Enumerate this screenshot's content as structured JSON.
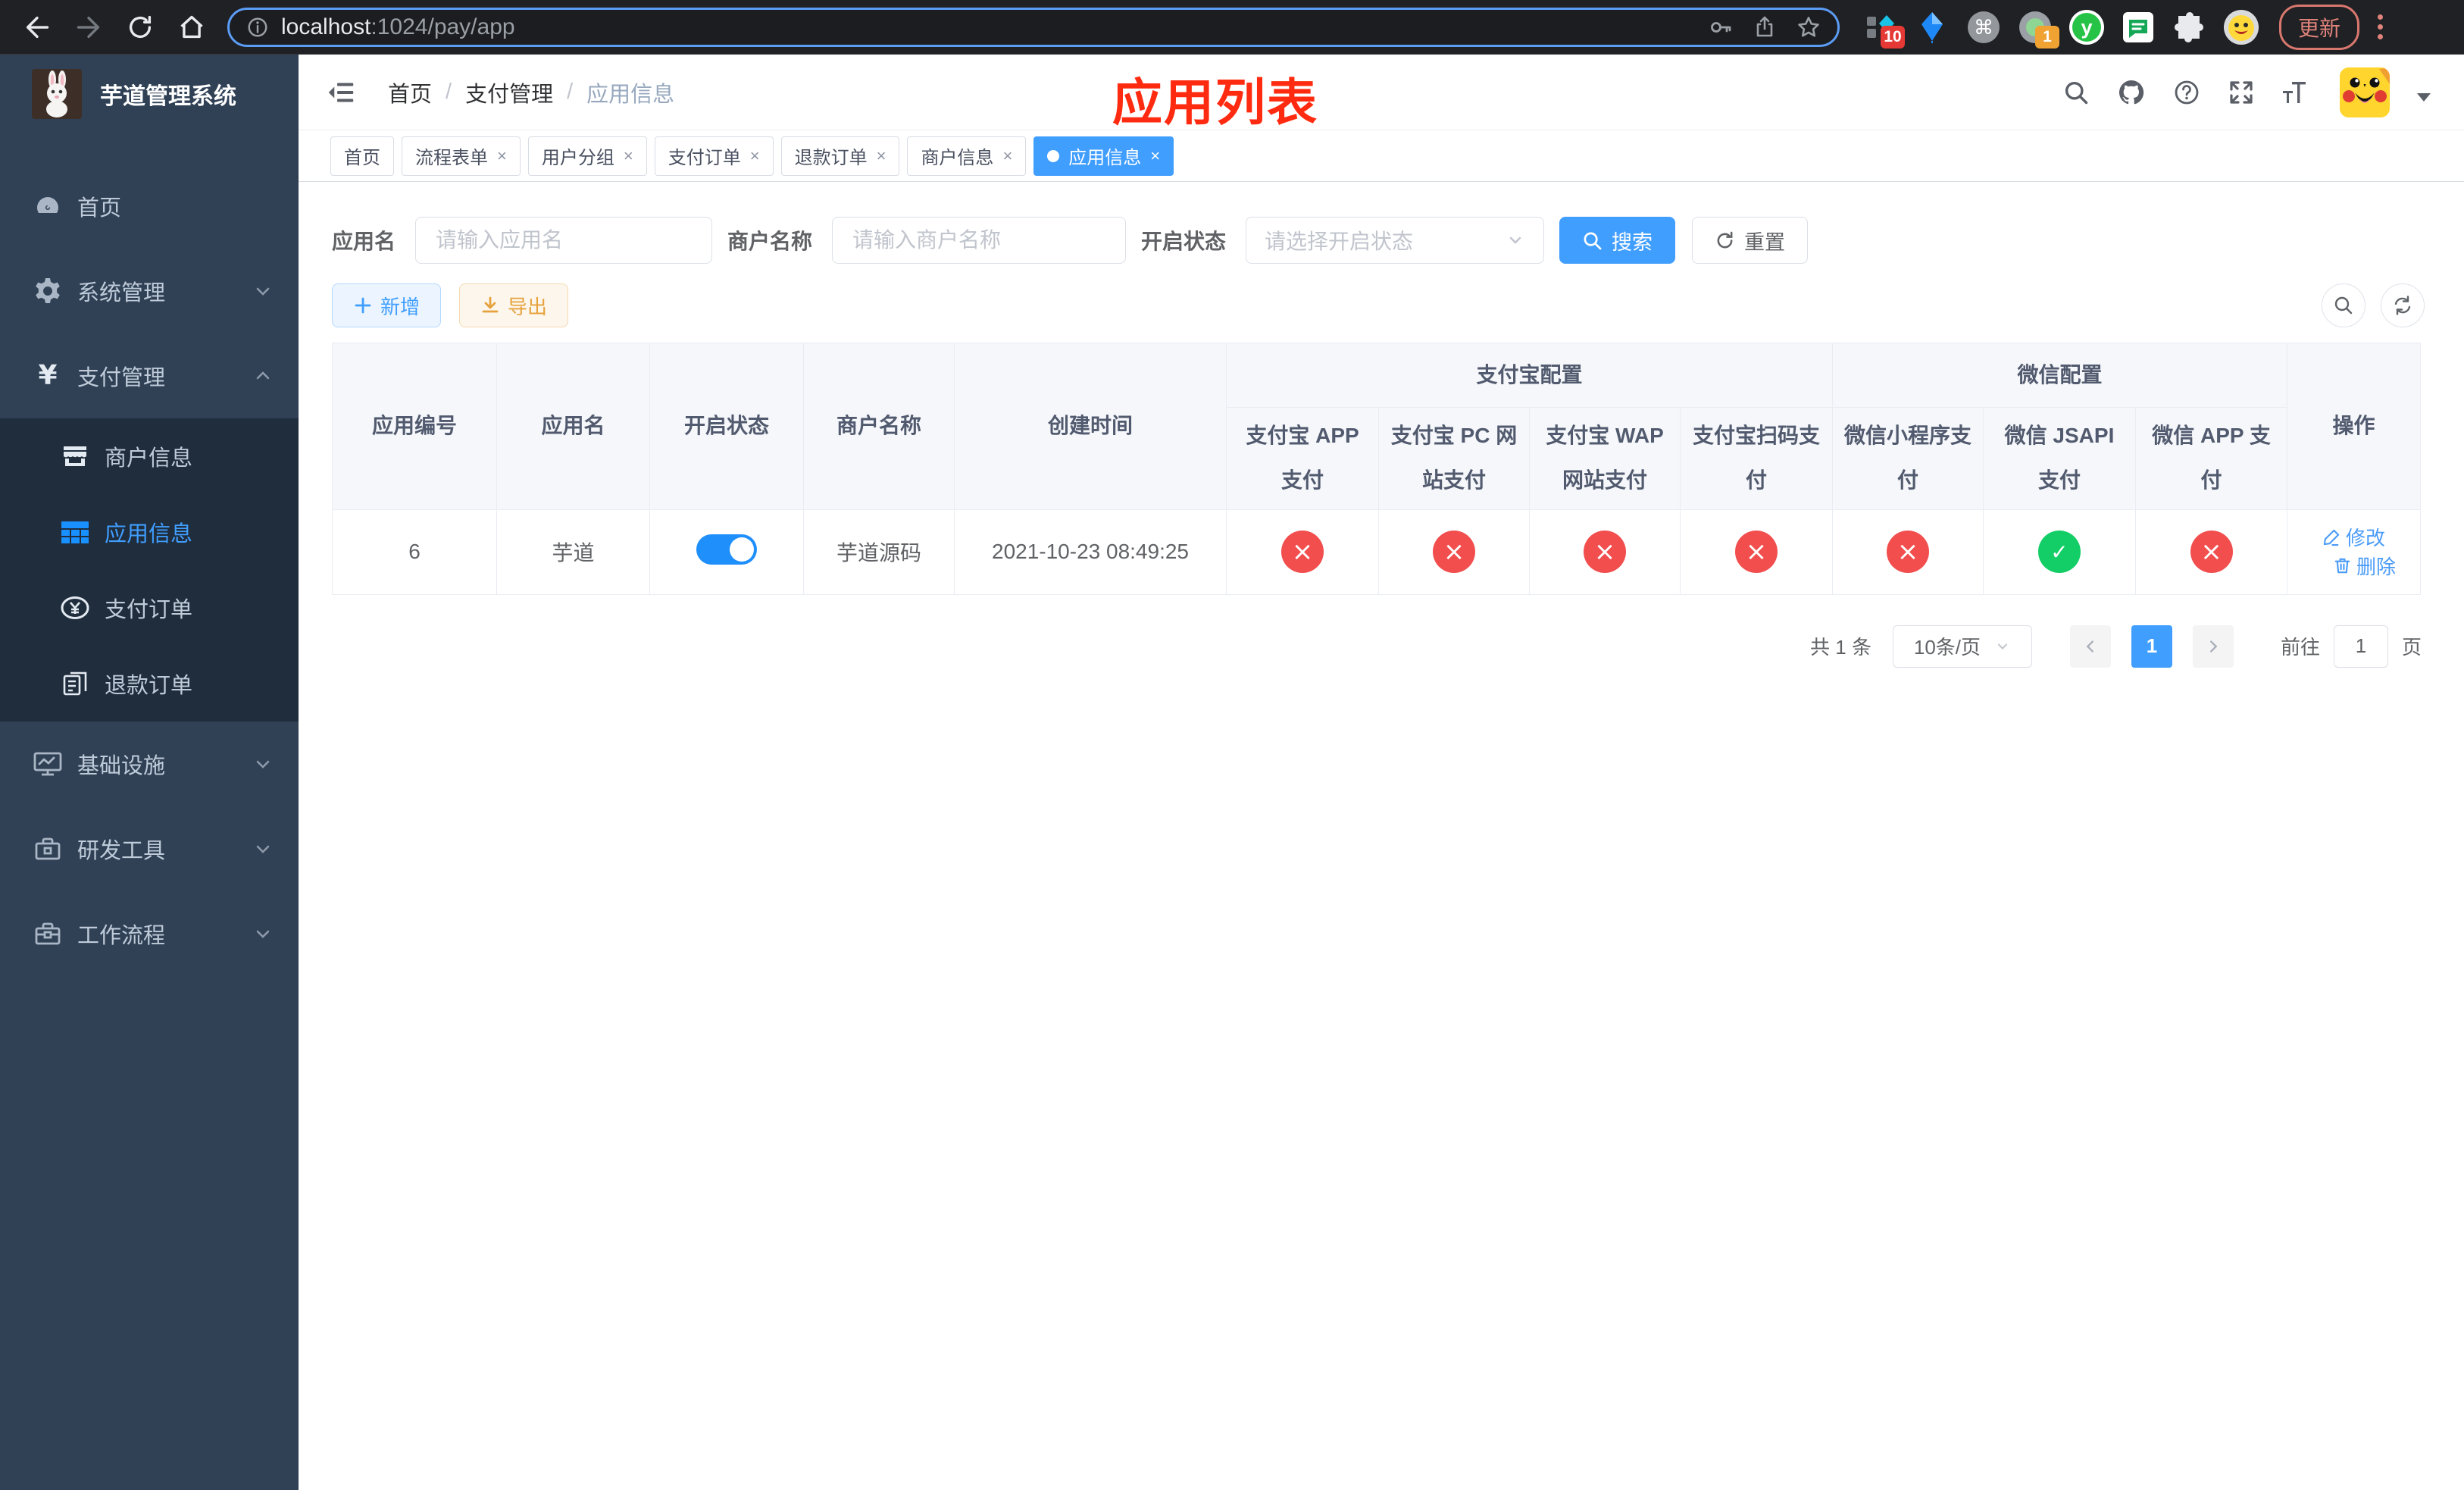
{
  "colors": {
    "accent": "#409eff",
    "success": "#13ce66",
    "danger": "#f24e4e",
    "warning": "#e6a23c",
    "annotation": "#ff2b10",
    "sidebar_bg": "#304156",
    "submenu_bg": "#1f2d3d"
  },
  "browser": {
    "url_host": "localhost",
    "url_path": ":1024/pay/app",
    "ext_badge_pinned": "10",
    "ext_badge_recorder": "1",
    "update_button": "更新"
  },
  "sidebar": {
    "title": "芋道管理系统",
    "menu": [
      {
        "label": "首页"
      },
      {
        "label": "系统管理"
      },
      {
        "label": "支付管理"
      },
      {
        "label": "商户信息"
      },
      {
        "label": "应用信息"
      },
      {
        "label": "支付订单"
      },
      {
        "label": "退款订单"
      },
      {
        "label": "基础设施"
      },
      {
        "label": "研发工具"
      },
      {
        "label": "工作流程"
      }
    ]
  },
  "navbar": {
    "breadcrumb": [
      "首页",
      "支付管理",
      "应用信息"
    ],
    "annotation": "应用列表"
  },
  "tags": [
    {
      "label": "首页"
    },
    {
      "label": "流程表单"
    },
    {
      "label": "用户分组"
    },
    {
      "label": "支付订单"
    },
    {
      "label": "退款订单"
    },
    {
      "label": "商户信息"
    },
    {
      "label": "应用信息"
    }
  ],
  "filters": {
    "app_name_label": "应用名",
    "app_name_placeholder": "请输入应用名",
    "merchant_label": "商户名称",
    "merchant_placeholder": "请输入商户名称",
    "status_label": "开启状态",
    "status_placeholder": "请选择开启状态",
    "search_button": "搜索",
    "reset_button": "重置"
  },
  "toolbar": {
    "add_button": "新增",
    "export_button": "导出"
  },
  "table": {
    "headers": {
      "app_id": "应用编号",
      "app_name": "应用名",
      "status": "开启状态",
      "merchant": "商户名称",
      "created": "创建时间",
      "group_alipay": "支付宝配置",
      "group_wechat": "微信配置",
      "alipay_app": "支付宝 APP 支付",
      "alipay_pc": "支付宝 PC 网站支付",
      "alipay_wap": "支付宝 WAP 网站支付",
      "alipay_qr": "支付宝扫码支付",
      "wx_mini": "微信小程序支付",
      "wx_jsapi": "微信 JSAPI 支付",
      "wx_app": "微信 APP 支付",
      "actions": "操作"
    },
    "row": {
      "app_id": "6",
      "app_name": "芋道",
      "status_enabled": true,
      "merchant": "芋道源码",
      "created": "2021-10-23 08:49:25",
      "alipay_app": "cross",
      "alipay_pc": "cross",
      "alipay_wap": "cross",
      "alipay_qr": "cross",
      "wx_mini": "cross",
      "wx_jsapi": "check",
      "wx_app": "cross",
      "edit_link": "修改",
      "delete_link": "删除"
    }
  },
  "pagination": {
    "total": "共 1 条",
    "page_size": "10条/页",
    "current_page": "1",
    "goto_label": "前往",
    "goto_value": "1",
    "page_unit": "页"
  }
}
